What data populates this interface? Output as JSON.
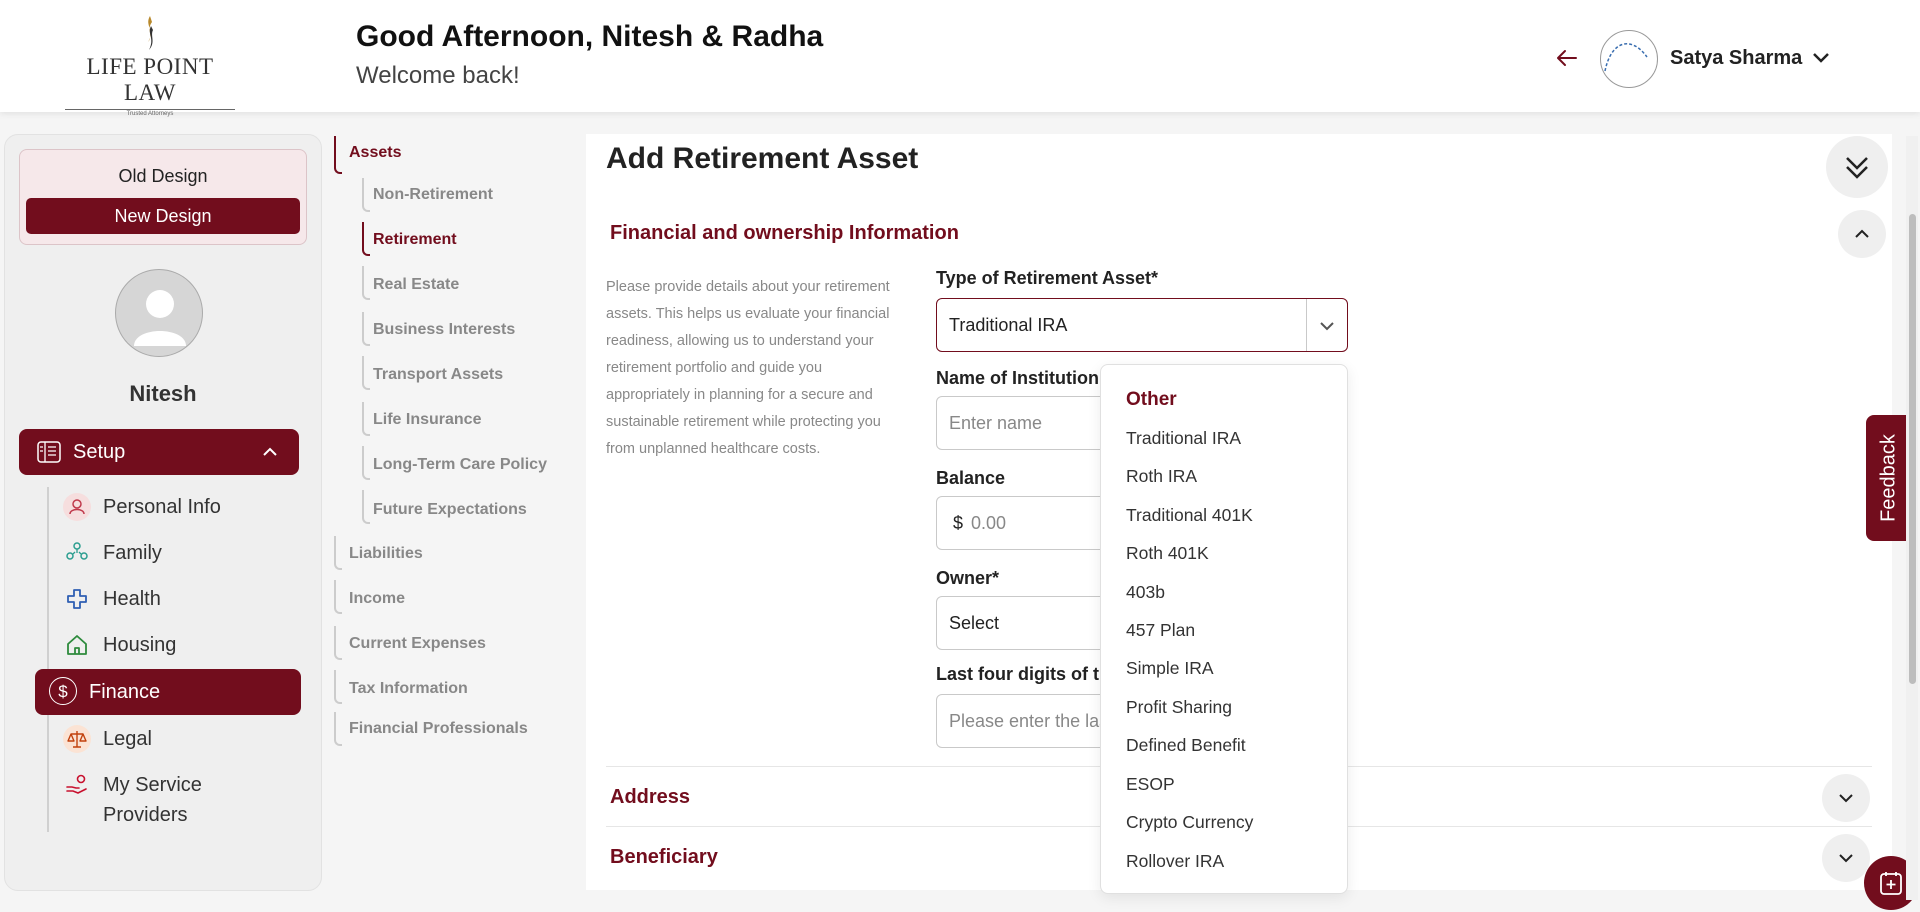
{
  "header": {
    "logo_name": "LIFE POINT LAW",
    "logo_tagline": "Trusted Attorneys",
    "greeting": "Good Afternoon, Nitesh & Radha",
    "welcome": "Welcome back!",
    "user_name": "Satya Sharma"
  },
  "sidebar": {
    "old_design": "Old Design",
    "new_design": "New Design",
    "profile_name": "Nitesh",
    "setup_label": "Setup",
    "items": [
      {
        "label": "Personal Info",
        "icon": "person-icon"
      },
      {
        "label": "Family",
        "icon": "family-icon"
      },
      {
        "label": "Health",
        "icon": "health-cross-icon"
      },
      {
        "label": "Housing",
        "icon": "home-icon"
      },
      {
        "label": "Finance",
        "icon": "dollar-icon",
        "active": true
      },
      {
        "label": "Legal",
        "icon": "scales-icon"
      },
      {
        "label": "My Service",
        "label2": "Providers",
        "icon": "service-hand-icon"
      }
    ]
  },
  "subnav": {
    "assets": "Assets",
    "asset_children": [
      "Non-Retirement",
      "Retirement",
      "Real Estate",
      "Business Interests",
      "Transport Assets",
      "Life Insurance",
      "Long-Term Care Policy",
      "Future Expectations"
    ],
    "others": [
      "Liabilities",
      "Income",
      "Current Expenses",
      "Tax Information",
      "Financial Professionals"
    ]
  },
  "main": {
    "title": "Add Retirement Asset",
    "section_financial": "Financial and ownership Information",
    "description": "Please provide details about your retirement assets. This helps us evaluate your financial readiness, allowing us to understand your retirement portfolio and guide you appropriately in planning for a secure and sustainable retirement while protecting you from unplanned healthcare costs.",
    "type_label": "Type of Retirement Asset*",
    "type_value": "Traditional IRA",
    "institution_label": "Name of Institution",
    "institution_placeholder": "Enter name",
    "balance_label": "Balance",
    "currency": "$",
    "balance_placeholder": "0.00",
    "owner_label": "Owner*",
    "owner_value": "Select",
    "last_four_label": "Last four digits of th",
    "last_four_placeholder": "Please enter the las",
    "section_address": "Address",
    "section_beneficiary": "Beneficiary"
  },
  "dropdown": {
    "options": [
      "Other",
      "Traditional IRA",
      "Roth IRA",
      "Traditional 401K",
      "Roth 401K",
      "403b",
      "457 Plan",
      "Simple IRA",
      "Profit Sharing",
      "Defined Benefit",
      "ESOP",
      "Crypto Currency",
      "Rollover IRA"
    ]
  },
  "feedback_label": "Feedback",
  "colors": {
    "accent": "#720d1d"
  }
}
